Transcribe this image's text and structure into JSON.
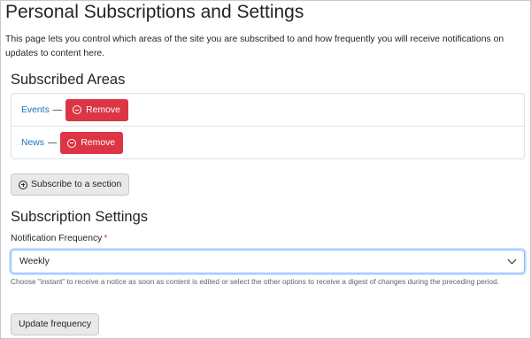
{
  "page": {
    "title": "Personal Subscriptions and Settings",
    "intro": "This page lets you control which areas of the site you are subscribed to and how frequently you will receive notifications on updates to content here."
  },
  "subscribed_areas": {
    "heading": "Subscribed Areas",
    "items": [
      {
        "name": "Events",
        "separator": "—",
        "remove_label": "Remove",
        "icon": "minus-circle-icon"
      },
      {
        "name": "News",
        "separator": "—",
        "remove_label": "Remove",
        "icon": "minus-circle-icon"
      }
    ],
    "subscribe_label": "Subscribe to a section",
    "subscribe_icon": "plus-circle-icon"
  },
  "settings": {
    "heading": "Subscription Settings",
    "frequency_label": "Notification Frequency",
    "required_marker": "*",
    "selected_value": "Weekly",
    "help_text": "Choose \"instant\" to receive a notice as soon as content is edited or select the other options to receive a digest of changes during the preceding period.",
    "update_label": "Update frequency"
  },
  "colors": {
    "remove_button": "#dc3545",
    "link": "#1f6fb5",
    "focus_border": "#86b7fe",
    "required": "#dc3545"
  }
}
